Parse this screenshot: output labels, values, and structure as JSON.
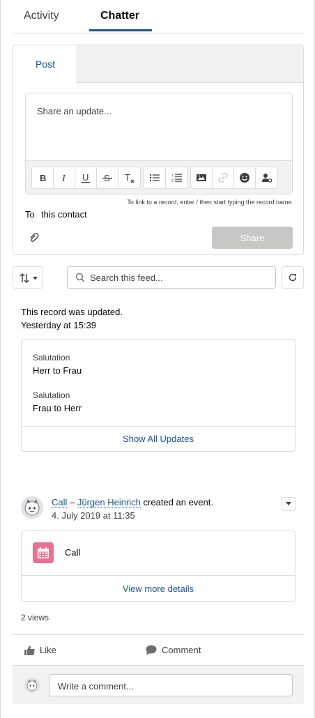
{
  "tabs": [
    {
      "label": "Activity"
    },
    {
      "label": "Chatter"
    }
  ],
  "publisher": {
    "tab_label": "Post",
    "placeholder": "Share an update...",
    "toolbar_buttons": [
      "bold-icon",
      "italic-icon",
      "underline-icon",
      "strikethrough-icon",
      "remove-formatting-icon",
      "bulleted-list-icon",
      "numbered-list-icon",
      "image-icon",
      "link-icon",
      "emoji-icon",
      "mention-icon"
    ],
    "hint": "To link to a record, enter / then start typing the record name.",
    "to_label": "To",
    "to_value": "this contact",
    "share_label": "Share"
  },
  "feed": {
    "search_placeholder": "Search this feed..."
  },
  "update_post": {
    "title": "This record was updated.",
    "timestamp": "Yesterday at 15:39",
    "changes": [
      {
        "label": "Salutation",
        "value": "Herr to Frau"
      },
      {
        "label": "Salutation",
        "value": "Frau to Herr"
      }
    ],
    "show_all_label": "Show All Updates"
  },
  "event_post": {
    "record_link": "Call",
    "separator": " – ",
    "user_link": "Jürgen Heinrich",
    "action_text": " created an event.",
    "timestamp": "4. July 2019 at 11:35",
    "event_name": "Call",
    "view_more_label": "View more details",
    "views": "2 views",
    "like_label": "Like",
    "comment_label": "Comment",
    "comment_placeholder": "Write a comment..."
  },
  "colors": {
    "brand": "#1b5297",
    "event_icon": "#eb7092",
    "share_disabled": "#c9c7c5"
  }
}
